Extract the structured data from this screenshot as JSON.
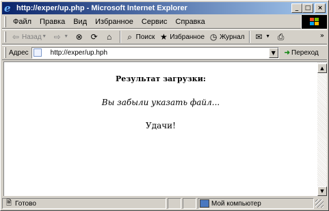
{
  "window": {
    "title": "http://exper/up.php - Microsoft Internet Explorer"
  },
  "window_buttons": {
    "minimize": "_",
    "maximize": "□",
    "close": "×"
  },
  "menu": [
    "Файл",
    "Правка",
    "Вид",
    "Избранное",
    "Сервис",
    "Справка"
  ],
  "toolbar": {
    "back": "Назад",
    "search": "Поиск",
    "favorites": "Избранное",
    "journal": "Журнал",
    "more": "»"
  },
  "address": {
    "label": "Адрес",
    "value": "http://exper/up.hph",
    "go": "Переход"
  },
  "page": {
    "heading": "Результат загрузки:",
    "message": "Вы забыли указать файл...",
    "luck": "Удачи!"
  },
  "status": {
    "text": "Готово",
    "zone": "Мой компьютер"
  },
  "colors": {
    "title_start": "#0a246a",
    "title_end": "#a6caf0",
    "chrome": "#d4d0c8"
  },
  "icons": [
    "ie-logo-icon",
    "back-arrow-icon",
    "forward-arrow-icon",
    "stop-icon",
    "refresh-icon",
    "home-icon",
    "search-icon",
    "favorites-icon",
    "history-icon",
    "mail-icon",
    "print-icon",
    "page-icon",
    "go-arrow-icon",
    "windows-flag-icon",
    "computer-icon",
    "status-page-icon"
  ]
}
